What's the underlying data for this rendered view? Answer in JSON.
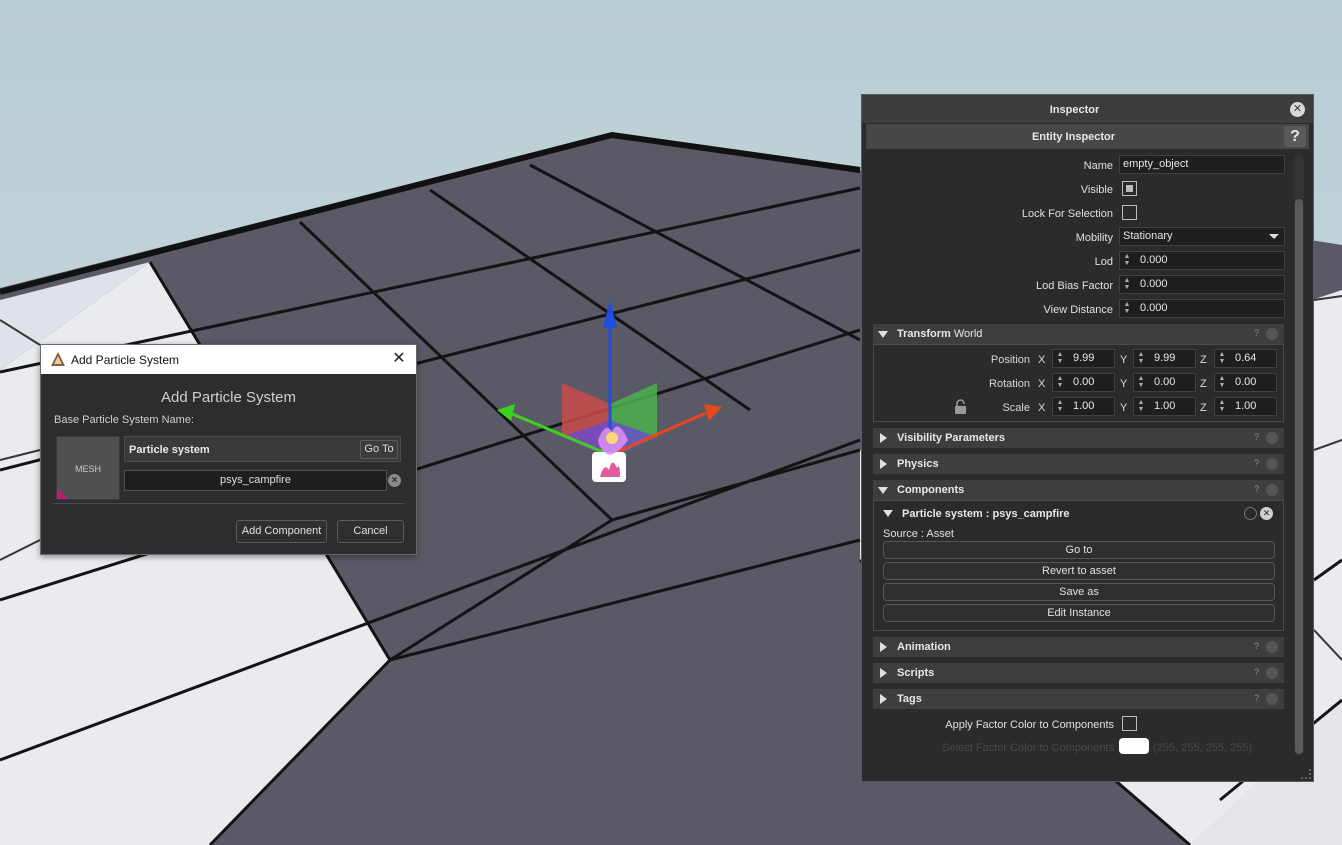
{
  "dialog": {
    "title": "Add Particle System",
    "heading": "Add Particle System",
    "base_label": "Base Particle System Name:",
    "thumbnail_label": "MESH",
    "name_value": "Particle system",
    "goto_label": "Go To",
    "asset_value": "psys_campfire",
    "add_label": "Add Component",
    "cancel_label": "Cancel"
  },
  "inspector": {
    "title": "Inspector",
    "subtitle": "Entity Inspector",
    "help": "?",
    "fields": {
      "name_label": "Name",
      "name_value": "empty_object",
      "visible_label": "Visible",
      "visible_checked": true,
      "lock_label": "Lock For Selection",
      "lock_checked": false,
      "mobility_label": "Mobility",
      "mobility_value": "Stationary",
      "lod_label": "Lod",
      "lod_value": "0.000",
      "lodbias_label": "Lod Bias Factor",
      "lodbias_value": "0.000",
      "viewdist_label": "View Distance",
      "viewdist_value": "0.000"
    },
    "transform": {
      "title": "Transform",
      "mode": "World",
      "position_label": "Position",
      "rotation_label": "Rotation",
      "scale_label": "Scale",
      "axis_x": "X",
      "axis_y": "Y",
      "axis_z": "Z",
      "position": [
        "9.99",
        "9.99",
        "0.64"
      ],
      "rotation": [
        "0.00",
        "0.00",
        "0.00"
      ],
      "scale": [
        "1.00",
        "1.00",
        "1.00"
      ]
    },
    "sections": {
      "visibility": "Visibility Parameters",
      "physics": "Physics",
      "components": "Components",
      "animation": "Animation",
      "scripts": "Scripts",
      "tags": "Tags",
      "help_mark": "?"
    },
    "particle": {
      "title": "Particle system : psys_campfire",
      "source": "Source : Asset",
      "goto": "Go to",
      "revert": "Revert to asset",
      "saveas": "Save as",
      "edit": "Edit Instance"
    },
    "factor": {
      "apply_label": "Apply Factor Color to Components",
      "apply_checked": false,
      "select_label": "Select Factor Color to Components",
      "color_value": "(255, 255, 255, 255)",
      "color_swatch": "#ffffff"
    }
  },
  "colors": {
    "gizmo_x": "#e8461e",
    "gizmo_y": "#3bd11f",
    "gizmo_z": "#1f4fe0",
    "sky": "#b8cdd5",
    "accent_mesh": "#c2187a"
  }
}
